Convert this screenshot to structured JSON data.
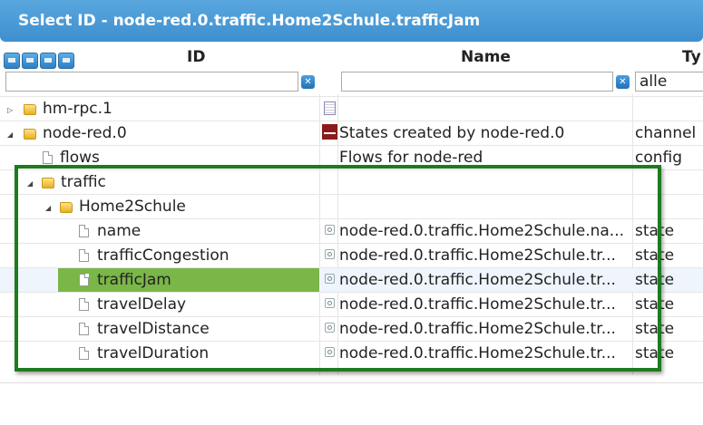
{
  "dialog": {
    "title": "Select ID - node-red.0.traffic.Home2Schule.trafficJam"
  },
  "columns": {
    "id": "ID",
    "name": "Name",
    "type": "Ty"
  },
  "filters": {
    "id_value": "",
    "name_value": "",
    "type_value": "alle"
  },
  "toolbar": {
    "icons": [
      "refresh-icon",
      "list-icon",
      "folder-collapse-icon",
      "folder-expand-icon"
    ]
  },
  "colors": {
    "title_bar": "#3d8fcf",
    "selection": "#7ab648",
    "highlight_frame": "#1f7a1f"
  },
  "rows": [
    {
      "label": "hm-rpc.1",
      "name": "",
      "type": ""
    },
    {
      "label": "node-red.0",
      "name": "States created by node-red.0",
      "type": "channel"
    },
    {
      "label": "flows",
      "name": "Flows for node-red",
      "type": "config"
    },
    {
      "label": "traffic",
      "name": "",
      "type": ""
    },
    {
      "label": "Home2Schule",
      "name": "",
      "type": ""
    },
    {
      "label": "name",
      "name": "node-red.0.traffic.Home2Schule.na...",
      "type": "state"
    },
    {
      "label": "trafficCongestion",
      "name": "node-red.0.traffic.Home2Schule.tr...",
      "type": "state"
    },
    {
      "label": "trafficJam",
      "name": "node-red.0.traffic.Home2Schule.tr...",
      "type": "state"
    },
    {
      "label": "travelDelay",
      "name": "node-red.0.traffic.Home2Schule.tr...",
      "type": "state"
    },
    {
      "label": "travelDistance",
      "name": "node-red.0.traffic.Home2Schule.tr...",
      "type": "state"
    },
    {
      "label": "travelDuration",
      "name": "node-red.0.traffic.Home2Schule.tr...",
      "type": "state"
    }
  ]
}
